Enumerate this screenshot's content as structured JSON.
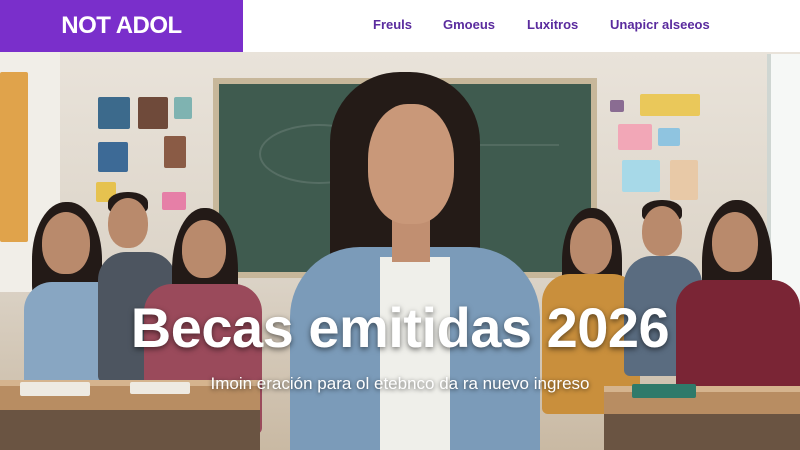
{
  "header": {
    "logo": "NOT ADOL",
    "nav": [
      "Freuls",
      "Gmoeus",
      "Luxitros",
      "Unapicr alseeos"
    ]
  },
  "hero": {
    "title": "Becas emitidas 2026",
    "subtitle": "Imoin eración para ol etebnco da ra nuevo ingreso"
  },
  "colors": {
    "brand": "#7a2fcb",
    "nav_text": "#5a2b9e",
    "header_bg": "#ffffff"
  }
}
